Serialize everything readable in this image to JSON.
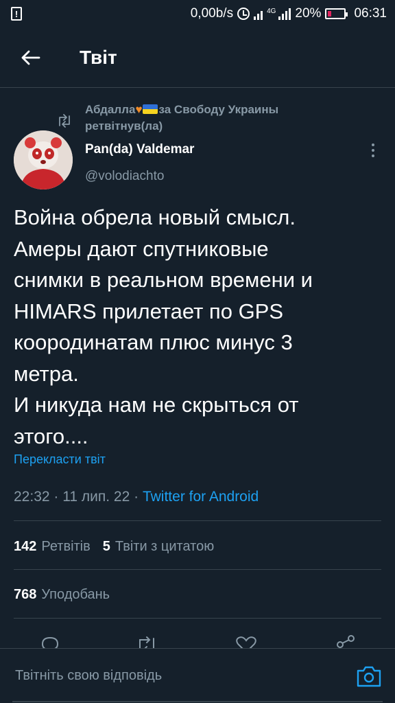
{
  "status_bar": {
    "speed": "0,00b/s",
    "net_type": "4G",
    "battery": "20%",
    "time": "06:31",
    "alert_glyph": "!"
  },
  "header": {
    "title": "Твіт"
  },
  "retweet": {
    "user_name": "Абдалла",
    "user_suffix": "за Свободу Украины",
    "action": "ретвітнув(ла)"
  },
  "author": {
    "name": "Pan(da) Valdemar",
    "handle": "@volodiachto"
  },
  "tweet": {
    "text": "Война обрела новый смысл.\nАмеры дают спутниковые\nснимки в реальном времени и\nHIMARS прилетает по GPS\nкоородинатам плюс минус 3\nметра.\nИ никуда нам не скрыться от\nэтого....",
    "translate_link": "Перекласти твіт",
    "time": "22:32",
    "date": "11 лип. 22",
    "separator": "·",
    "source": "Twitter for Android"
  },
  "stats": {
    "retweets_count": "142",
    "retweets_label": "Ретвітів",
    "quotes_count": "5",
    "quotes_label": "Твіти з цитатою",
    "likes_count": "768",
    "likes_label": "Уподобань"
  },
  "reply": {
    "placeholder": "Твітніть свою відповідь"
  },
  "colors": {
    "background": "#15202b",
    "accent": "#1da1f2",
    "secondary_text": "#8899a6",
    "divider": "#38444d"
  },
  "icons": {
    "back": "arrow-left-icon",
    "retweet": "retweet-icon",
    "more": "more-vertical-icon",
    "reply": "reply-icon",
    "like": "heart-icon",
    "share": "share-icon",
    "camera": "camera-icon"
  }
}
